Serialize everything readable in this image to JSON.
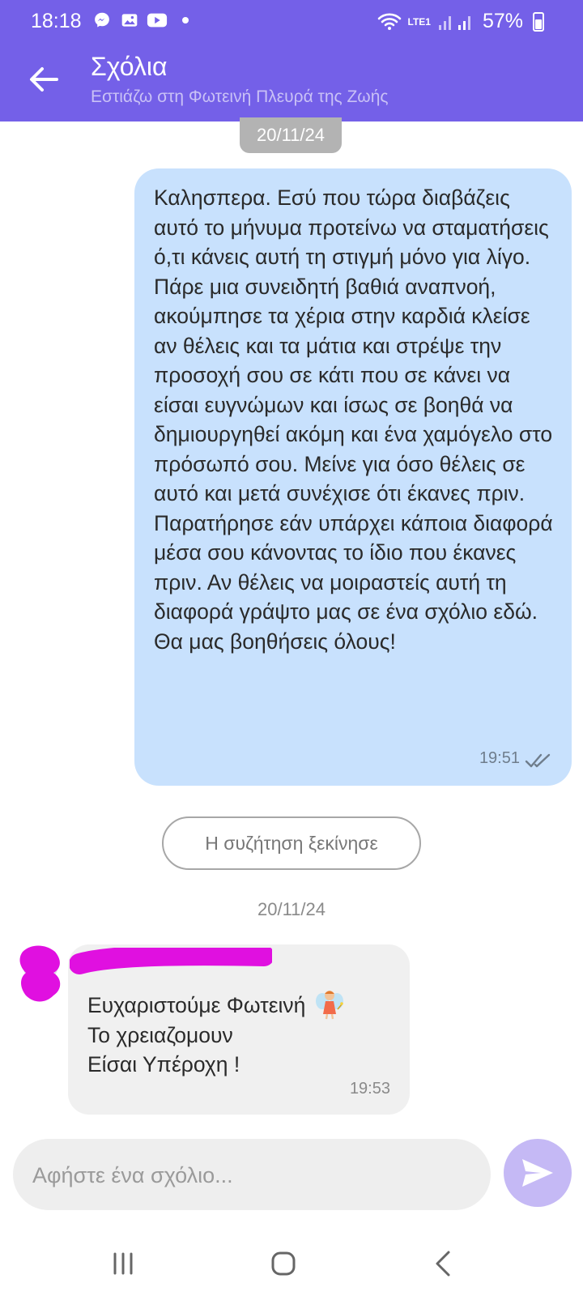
{
  "status_bar": {
    "time": "18:18",
    "battery": "57%",
    "network": "LTE1",
    "icons": [
      "messenger-icon",
      "gallery-icon",
      "youtube-icon",
      "wifi-icon",
      "signal-icon"
    ]
  },
  "header": {
    "title": "Σχόλια",
    "subtitle": "Εστιάζω στη Φωτεινή Πλευρά της Ζωής"
  },
  "chat": {
    "date_top": "20/11/24",
    "outgoing_message": {
      "text": "Καλησπερα. Εσύ που τώρα διαβάζεις αυτό το μήνυμα προτείνω να σταματήσεις ό,τι κάνεις αυτή τη στιγμή μόνο για λίγο. Πάρε μια συνειδητή βαθιά αναπνοή, ακούμπησε τα χέρια στην καρδιά κλείσε αν θέλεις και τα μάτια και στρέψε την προσοχή σου σε κάτι που σε κάνει να είσαι ευγνώμων και ίσως σε βοηθά να δημιουργηθεί ακόμη και ένα χαμόγελο στο πρόσωπό σου. Μείνε για όσο θέλεις σε αυτό και μετά συνέχισε ότι έκανες πριν. Παρατήρησε εάν υπάρχει κάποια διαφορά μέσα σου κάνοντας το ίδιο που έκανες πριν. Αν θέλεις να μοιραστείς αυτή τη διαφορά γράψτο μας σε ένα σχόλιο εδώ. Θα μας βοηθήσεις όλους!",
      "time": "19:51",
      "status_icon": "double-check-icon"
    },
    "conversation_started": "Η συζήτηση ξεκίνησε",
    "date_second": "20/11/24",
    "incoming_message": {
      "lines": [
        "Ευχαριστούμε Φωτεινή",
        "Το χρειαζομουν",
        "Είσαι Υπέροχη !"
      ],
      "emoji": "fairy-emoji",
      "time": "19:53"
    }
  },
  "composer": {
    "placeholder": "Αφήστε ένα σχόλιο..."
  },
  "colors": {
    "header": "#7460e8",
    "outgoing_bubble": "#c8e1fd",
    "incoming_bubble": "#f0f0f0",
    "send_button": "#c5b9f5",
    "redaction": "#e010e0"
  }
}
